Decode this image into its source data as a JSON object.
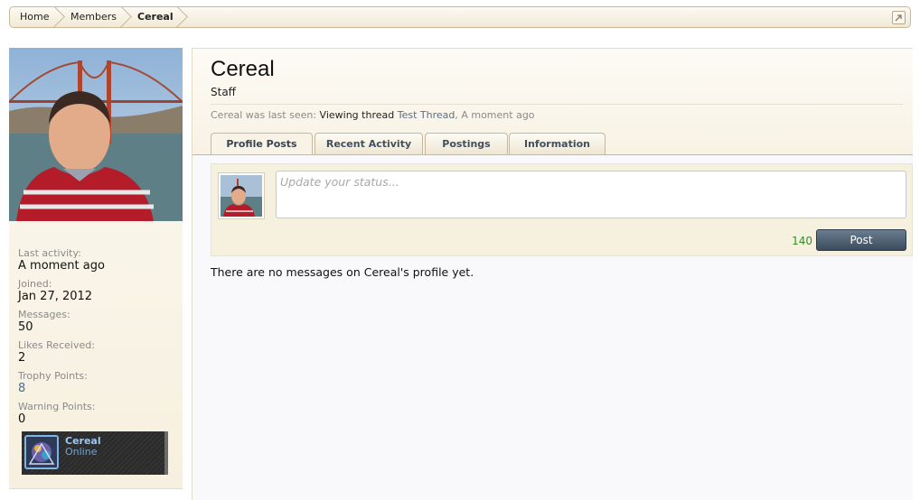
{
  "breadcrumb": {
    "items": [
      "Home",
      "Members"
    ],
    "current": "Cereal"
  },
  "sidebar": {
    "stats": [
      {
        "label": "Last activity:",
        "value": "A moment ago"
      },
      {
        "label": "Joined:",
        "value": "Jan 27, 2012"
      },
      {
        "label": "Messages:",
        "value": "50"
      },
      {
        "label": "Likes Received:",
        "value": "2"
      },
      {
        "label": "Trophy Points:",
        "value": "8"
      },
      {
        "label": "Warning Points:",
        "value": "0"
      }
    ],
    "online_card": {
      "name": "Cereal",
      "status": "Online"
    }
  },
  "profile": {
    "username": "Cereal",
    "title": "Staff",
    "last_seen": {
      "prefix": "Cereal was last seen:",
      "action": "Viewing thread",
      "thread": "Test Thread",
      "time": "A moment ago"
    }
  },
  "tabs": [
    "Profile Posts",
    "Recent Activity",
    "Postings",
    "Information"
  ],
  "status": {
    "placeholder": "Update your status...",
    "counter": "140",
    "post_label": "Post"
  },
  "empty_message": "There are no messages on Cereal's profile yet.",
  "colors": {
    "accent_link": "#4d6d8a",
    "counter_green": "#3a8a2a",
    "button_dark": "#3b4b5c"
  }
}
